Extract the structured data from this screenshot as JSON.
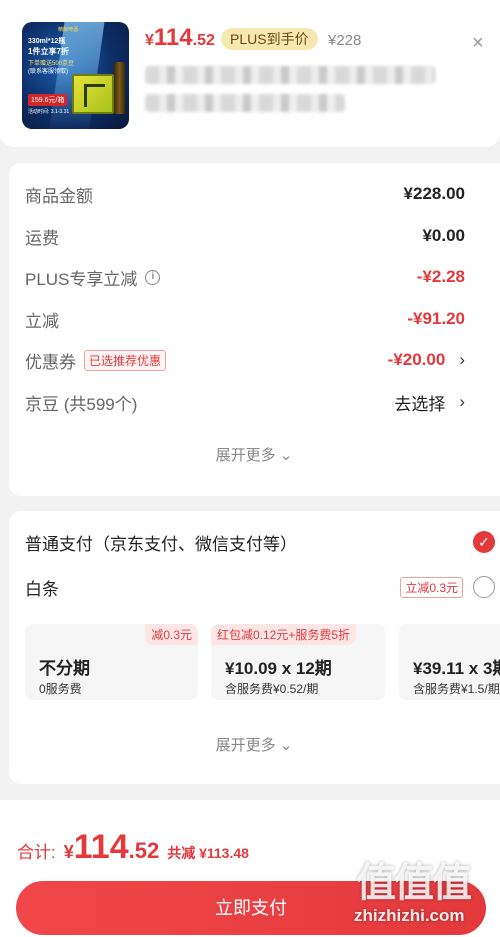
{
  "product": {
    "thumb_lines": [
      "精酿啤酒",
      "330ml*12瓶",
      "1件立享7折",
      "下单赠送500京豆",
      "(联系客服领取)",
      "159.6元/箱",
      "活动时间: 3.1-3.31"
    ],
    "price_yen": "¥",
    "price_int": "114",
    "price_dec": ".52",
    "plus_badge": "PLUS到手价",
    "original_price": "¥228",
    "close_label": "×"
  },
  "detail": {
    "rows": [
      {
        "label": "商品金额",
        "value": "¥228.00"
      },
      {
        "label": "运费",
        "value": "¥0.00"
      },
      {
        "label": "PLUS专享立减",
        "value": "-¥2.28"
      },
      {
        "label": "立减",
        "value": "-¥91.20"
      },
      {
        "label": "优惠券",
        "tag": "已选推荐优惠",
        "value": "-¥20.00"
      },
      {
        "label": "京豆 (共599个)",
        "value": "去选择"
      }
    ],
    "expand_label": "展开更多 ⌄"
  },
  "payment": {
    "normal_label": "普通支付（京东支付、微信支付等）",
    "baitiao_label": "白条",
    "baitiao_tag": "立减0.3元",
    "plans": [
      {
        "tag": "减0.3元",
        "main": "不分期",
        "sub": "0服务费"
      },
      {
        "tag": "红包减0.12元+服务费5折",
        "main": "¥10.09 x 12期",
        "sub": "含服务费¥0.52/期"
      },
      {
        "tag": "",
        "main": "¥39.11 x 3期",
        "sub": "含服务费¥1.5/期"
      }
    ],
    "expand_label": "展开更多 ⌄"
  },
  "footer": {
    "total_label": "合计:",
    "total_yen": "¥",
    "total_int": "114",
    "total_dec": ".52",
    "saved": "共减 ¥113.48",
    "pay_button": "立即支付"
  },
  "watermark": {
    "big": "值值值",
    "small": "zhizhizhi.com"
  },
  "colors": {
    "accent": "#e4393c",
    "background": "#f2f2f2",
    "plus_badge_bg": "#f7e7b0"
  }
}
